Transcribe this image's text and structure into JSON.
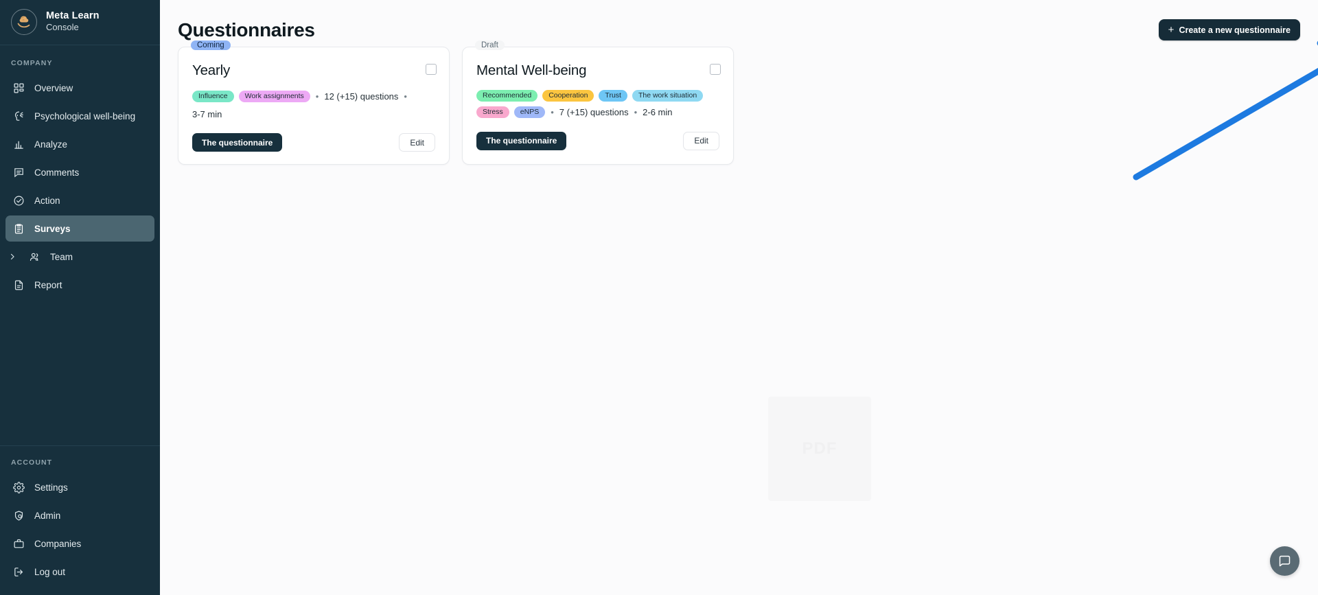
{
  "brand": {
    "name": "Meta Learn",
    "subtitle": "Console",
    "logo_icon": "brain-in-hand-logo"
  },
  "sidebar": {
    "sections": [
      {
        "heading": "COMPANY",
        "items": [
          {
            "label": "Overview",
            "icon": "grid-icon",
            "active": false,
            "caret": false
          },
          {
            "label": "Psychological well-being",
            "icon": "head-wellbeing-icon",
            "active": false,
            "caret": false
          },
          {
            "label": "Analyze",
            "icon": "bar-chart-icon",
            "active": false,
            "caret": false
          },
          {
            "label": "Comments",
            "icon": "message-square-icon",
            "active": false,
            "caret": false
          },
          {
            "label": "Action",
            "icon": "check-circle-icon",
            "active": false,
            "caret": false
          },
          {
            "label": "Surveys",
            "icon": "clipboard-list-icon",
            "active": true,
            "caret": false
          },
          {
            "label": "Team",
            "icon": "users-icon",
            "active": false,
            "caret": true
          },
          {
            "label": "Report",
            "icon": "file-text-icon",
            "active": false,
            "caret": false
          }
        ]
      },
      {
        "heading": "ACCOUNT",
        "items": [
          {
            "label": "Settings",
            "icon": "gear-icon",
            "active": false,
            "caret": false
          },
          {
            "label": "Admin",
            "icon": "shield-user-icon",
            "active": false,
            "caret": false
          },
          {
            "label": "Companies",
            "icon": "briefcase-icon",
            "active": false,
            "caret": false
          },
          {
            "label": "Log out",
            "icon": "logout-icon",
            "active": false,
            "caret": false
          }
        ]
      }
    ]
  },
  "main": {
    "title": "Questionnaires",
    "create_button": {
      "label": "Create a new questionnaire",
      "icon": "plus-icon"
    },
    "cards": [
      {
        "status": "Coming",
        "status_style": "coming",
        "title": "Yearly",
        "tags": [
          {
            "label": "Influence",
            "color": "#7ae7c7"
          },
          {
            "label": "Work assignments",
            "color": "#eda9f5"
          }
        ],
        "questions": "12 (+15) questions",
        "duration": "3-7 min",
        "primary_button": "The questionnaire",
        "secondary_button": "Edit"
      },
      {
        "status": "Draft",
        "status_style": "draft",
        "title": "Mental Well-being",
        "tags": [
          {
            "label": "Recommended",
            "color": "#7ceeb0"
          },
          {
            "label": "Cooperation",
            "color": "#fbc540"
          },
          {
            "label": "Trust",
            "color": "#6ec6f5"
          },
          {
            "label": "The work situation",
            "color": "#8fd9f2"
          },
          {
            "label": "Stress",
            "color": "#f9a8cd"
          },
          {
            "label": "eNPS",
            "color": "#9fb8f8"
          }
        ],
        "questions": "7 (+15) questions",
        "duration": "2-6 min",
        "primary_button": "The questionnaire",
        "secondary_button": "Edit"
      }
    ],
    "watermark_text": "PDF",
    "chat_fab_icon": "chat-bubble-icon"
  },
  "annotation": {
    "arrow_color": "#1d7ae0",
    "type": "pointer-arrow"
  }
}
